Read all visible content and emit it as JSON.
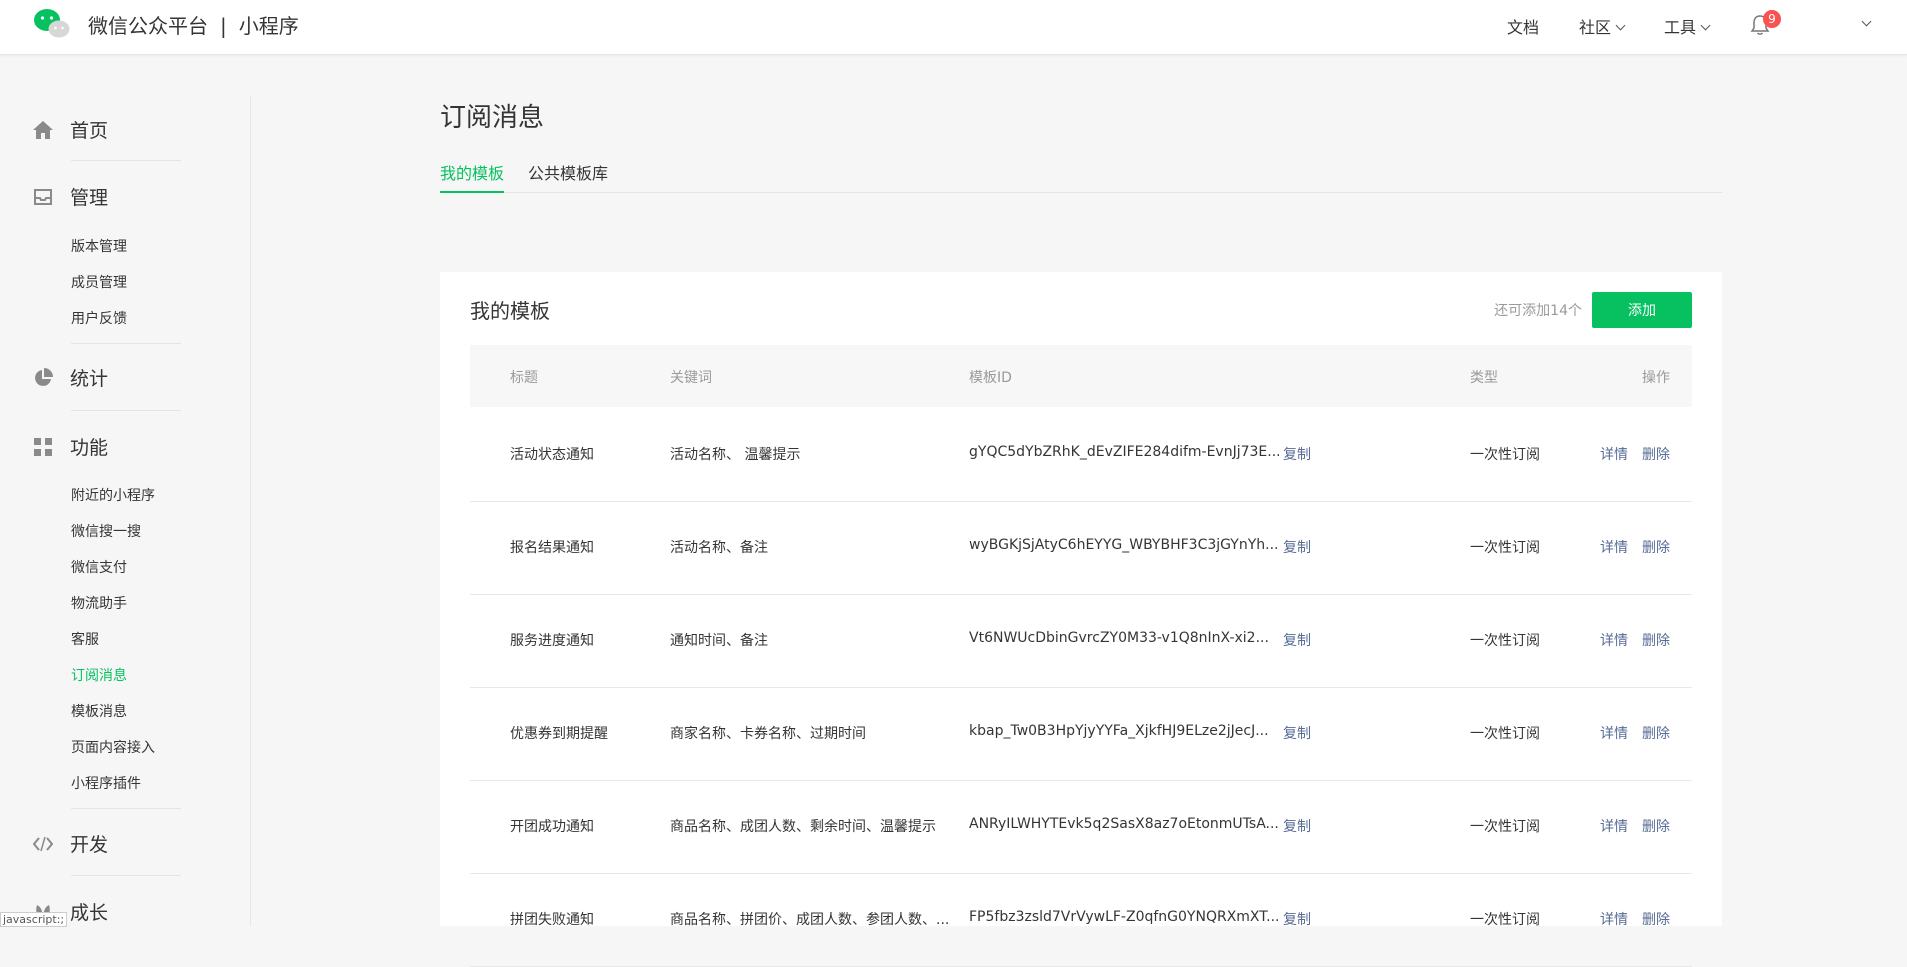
{
  "header": {
    "brand": "微信公众平台",
    "separator": "|",
    "product": "小程序",
    "nav": [
      {
        "label": "文档"
      },
      {
        "label": "社区"
      },
      {
        "label": "工具"
      }
    ],
    "notification_count": "9"
  },
  "sidebar": {
    "sections": [
      {
        "label": "首页",
        "icon": "home-icon"
      },
      {
        "label": "管理",
        "icon": "inbox-icon",
        "items": [
          "版本管理",
          "成员管理",
          "用户反馈"
        ]
      },
      {
        "label": "统计",
        "icon": "pie-chart-icon"
      },
      {
        "label": "功能",
        "icon": "grid-icon",
        "items": [
          "附近的小程序",
          "微信搜一搜",
          "微信支付",
          "物流助手",
          "客服",
          "订阅消息",
          "模板消息",
          "页面内容接入",
          "小程序插件"
        ]
      },
      {
        "label": "开发",
        "icon": "code-icon"
      },
      {
        "label": "成长",
        "icon": "leaf-icon"
      }
    ],
    "active_item": "订阅消息",
    "status_hint": "javascript:;"
  },
  "main": {
    "title": "订阅消息",
    "tabs": [
      {
        "label": "我的模板",
        "active": true
      },
      {
        "label": "公共模板库",
        "active": false
      }
    ],
    "card": {
      "title": "我的模板",
      "remaining": "还可添加14个",
      "add_label": "添加",
      "columns": [
        "标题",
        "关键词",
        "模板ID",
        "类型",
        "操作"
      ],
      "copy_label": "复制",
      "detail_label": "详情",
      "delete_label": "删除",
      "rows": [
        {
          "title": "活动状态通知",
          "keywords": "活动名称、 温馨提示",
          "template_id": "gYQC5dYbZRhK_dEvZIFE284difm-EvnJj73E...",
          "type": "一次性订阅"
        },
        {
          "title": "报名结果通知",
          "keywords": "活动名称、备注",
          "template_id": "wyBGKjSjAtyC6hEYYG_WBYBHF3C3jGYnYh...",
          "type": "一次性订阅"
        },
        {
          "title": "服务进度通知",
          "keywords": "通知时间、备注",
          "template_id": "Vt6NWUcDbinGvrcZY0M33-v1Q8nInX-xi2...",
          "type": "一次性订阅"
        },
        {
          "title": "优惠券到期提醒",
          "keywords": "商家名称、卡券名称、过期时间",
          "template_id": "kbap_Tw0B3HpYjyYYFa_XjkfHJ9ELze2jJecJ...",
          "type": "一次性订阅"
        },
        {
          "title": "开团成功通知",
          "keywords": "商品名称、成团人数、剩余时间、温馨提示",
          "template_id": "ANRyILWHYTEvk5q2SasX8az7oEtonmUTsA...",
          "type": "一次性订阅"
        },
        {
          "title": "拼团失败通知",
          "keywords": "商品名称、拼团价、成团人数、参团人数、...",
          "template_id": "FP5fbz3zsld7VrVywLF-Z0qfnG0YNQRXmXT...",
          "type": "一次性订阅"
        }
      ]
    }
  },
  "colors": {
    "accent": "#07c160",
    "link": "#576b95",
    "badge": "#fa5151"
  }
}
